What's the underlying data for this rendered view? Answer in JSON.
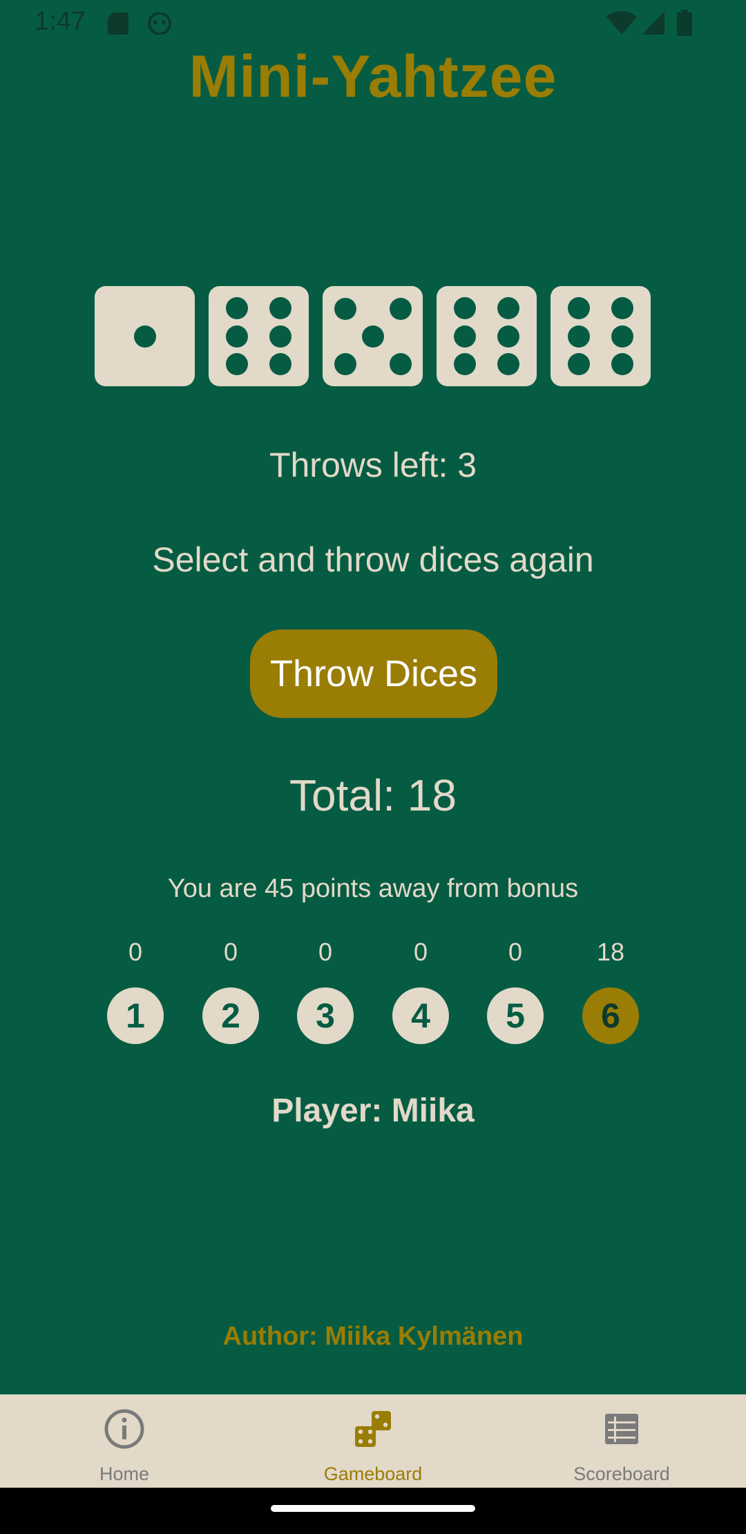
{
  "status_bar": {
    "time": "1:47"
  },
  "app": {
    "title": "Mini-Yahtzee"
  },
  "dice": [
    {
      "value": 1
    },
    {
      "value": 6
    },
    {
      "value": 5
    },
    {
      "value": 6
    },
    {
      "value": 6
    }
  ],
  "game": {
    "throws_left": "Throws left: 3",
    "status": "Select and throw dices again",
    "throw_button_label": "Throw Dices",
    "total": "Total: 18",
    "bonus_text": "You are 45 points away from bonus",
    "player": "Player: Miika",
    "author": "Author: Miika Kylmänen"
  },
  "points": [
    {
      "points": "0",
      "number": "1",
      "selected": false
    },
    {
      "points": "0",
      "number": "2",
      "selected": false
    },
    {
      "points": "0",
      "number": "3",
      "selected": false
    },
    {
      "points": "0",
      "number": "4",
      "selected": false
    },
    {
      "points": "0",
      "number": "5",
      "selected": false
    },
    {
      "points": "18",
      "number": "6",
      "selected": true
    }
  ],
  "nav": {
    "home_label": "Home",
    "gameboard_label": "Gameboard",
    "scoreboard_label": "Scoreboard",
    "active": "Gameboard"
  },
  "colors": {
    "background": "#065c42",
    "accent": "#9a7d05",
    "surface": "#e2d9c9"
  }
}
